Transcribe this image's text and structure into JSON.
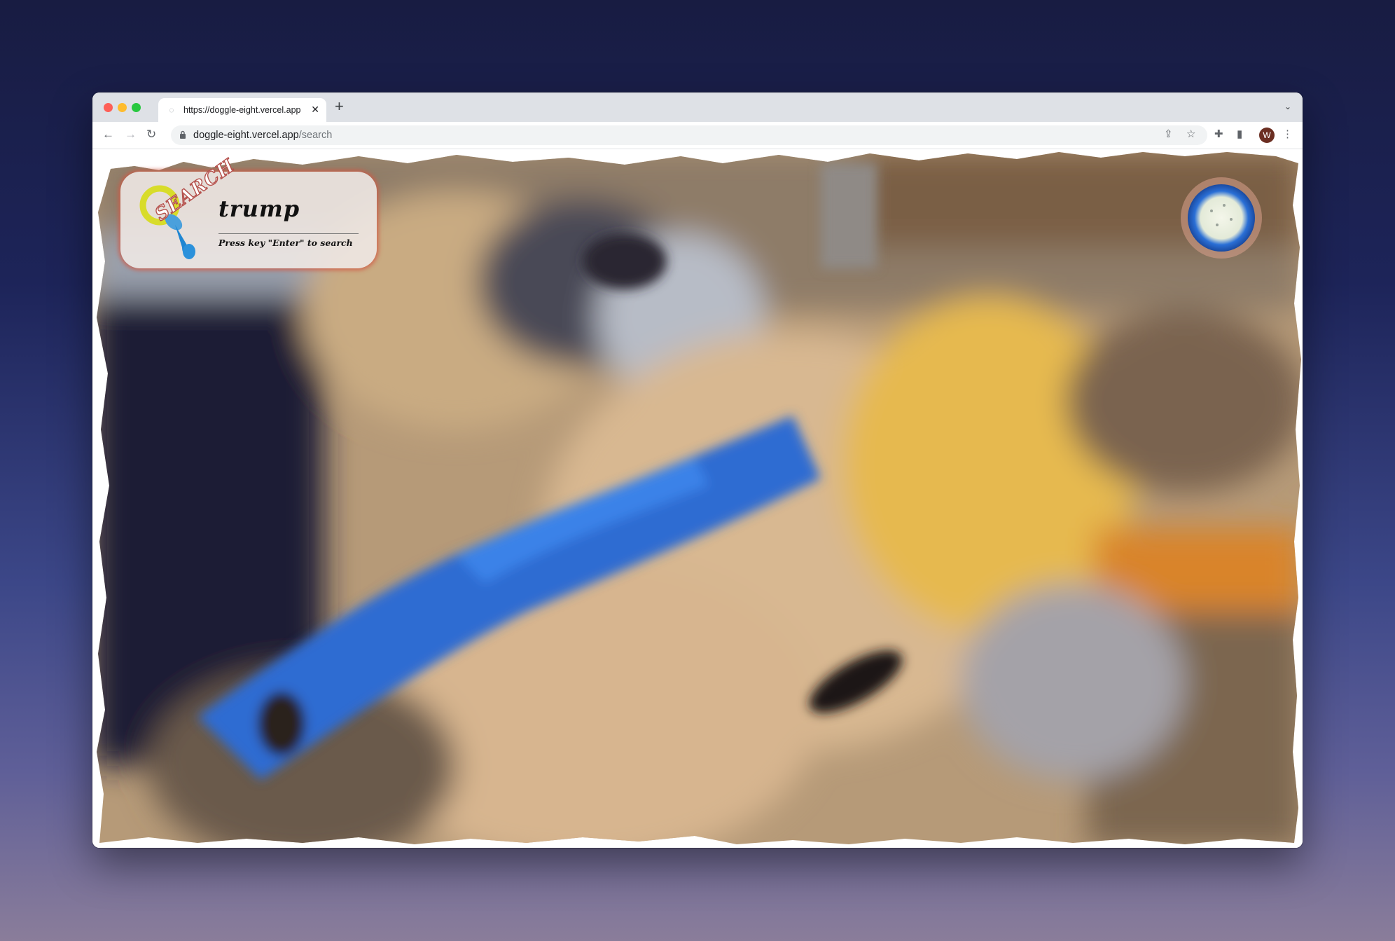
{
  "browser": {
    "tab": {
      "title": "https://doggle-eight.vercel.app",
      "favicon": "globe-icon"
    },
    "address": {
      "host": "doggle-eight.vercel.app",
      "path": "/search"
    },
    "profile_initial": "W"
  },
  "page": {
    "search_label": "SEARCH",
    "query": "trump",
    "hint": "Press key \"Enter\" to search"
  },
  "colors": {
    "backdrop_top": "#181c42",
    "backdrop_bottom": "#8a7d9a",
    "search_glow": "#d25a46",
    "ball_blue": "#2a6fd6"
  }
}
